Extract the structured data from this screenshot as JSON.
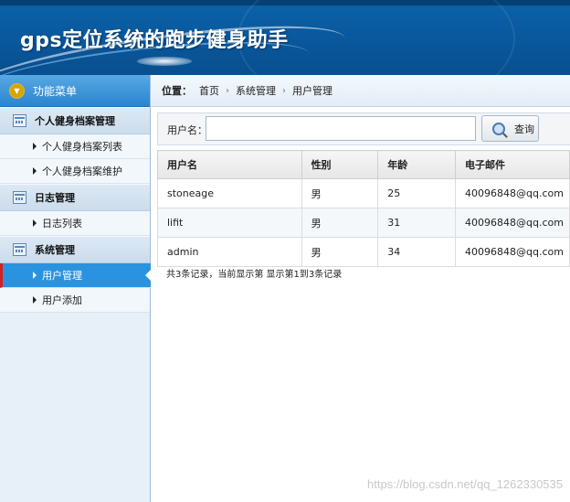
{
  "header": {
    "title": "gps定位系统的跑步健身助手"
  },
  "sidebar": {
    "menu_title": "功能菜单",
    "groups": [
      {
        "label": "个人健身档案管理",
        "items": [
          {
            "label": "个人健身档案列表"
          },
          {
            "label": "个人健身档案维护"
          }
        ]
      },
      {
        "label": "日志管理",
        "items": [
          {
            "label": "日志列表"
          }
        ]
      },
      {
        "label": "系统管理",
        "items": [
          {
            "label": "用户管理"
          },
          {
            "label": "用户添加"
          }
        ]
      }
    ]
  },
  "breadcrumb": {
    "label": "位置：",
    "items": [
      "首页",
      "系统管理",
      "用户管理"
    ]
  },
  "search": {
    "field_label": "用户名：",
    "value": "",
    "button_label": "查询"
  },
  "table": {
    "columns": [
      "用户名",
      "性别",
      "年龄",
      "电子邮件"
    ],
    "rows": [
      [
        "stoneage",
        "男",
        "25",
        "40096848@qq.com"
      ],
      [
        "lifit",
        "男",
        "31",
        "40096848@qq.com"
      ],
      [
        "admin",
        "男",
        "34",
        "40096848@qq.com"
      ]
    ]
  },
  "pager": {
    "text": "共3条记录，当前显示第  显示第1到3条记录"
  },
  "watermark": "https://blog.csdn.net/qq_1262330535",
  "colors": {
    "header_bg": "#0a5aa0",
    "active_item_bg": "#2a93e0",
    "active_marker": "#d62020"
  },
  "icons": {
    "menu": "chevron-down-icon",
    "group": "calendar-icon",
    "item": "triangle-right-icon",
    "search": "magnifier-icon"
  }
}
